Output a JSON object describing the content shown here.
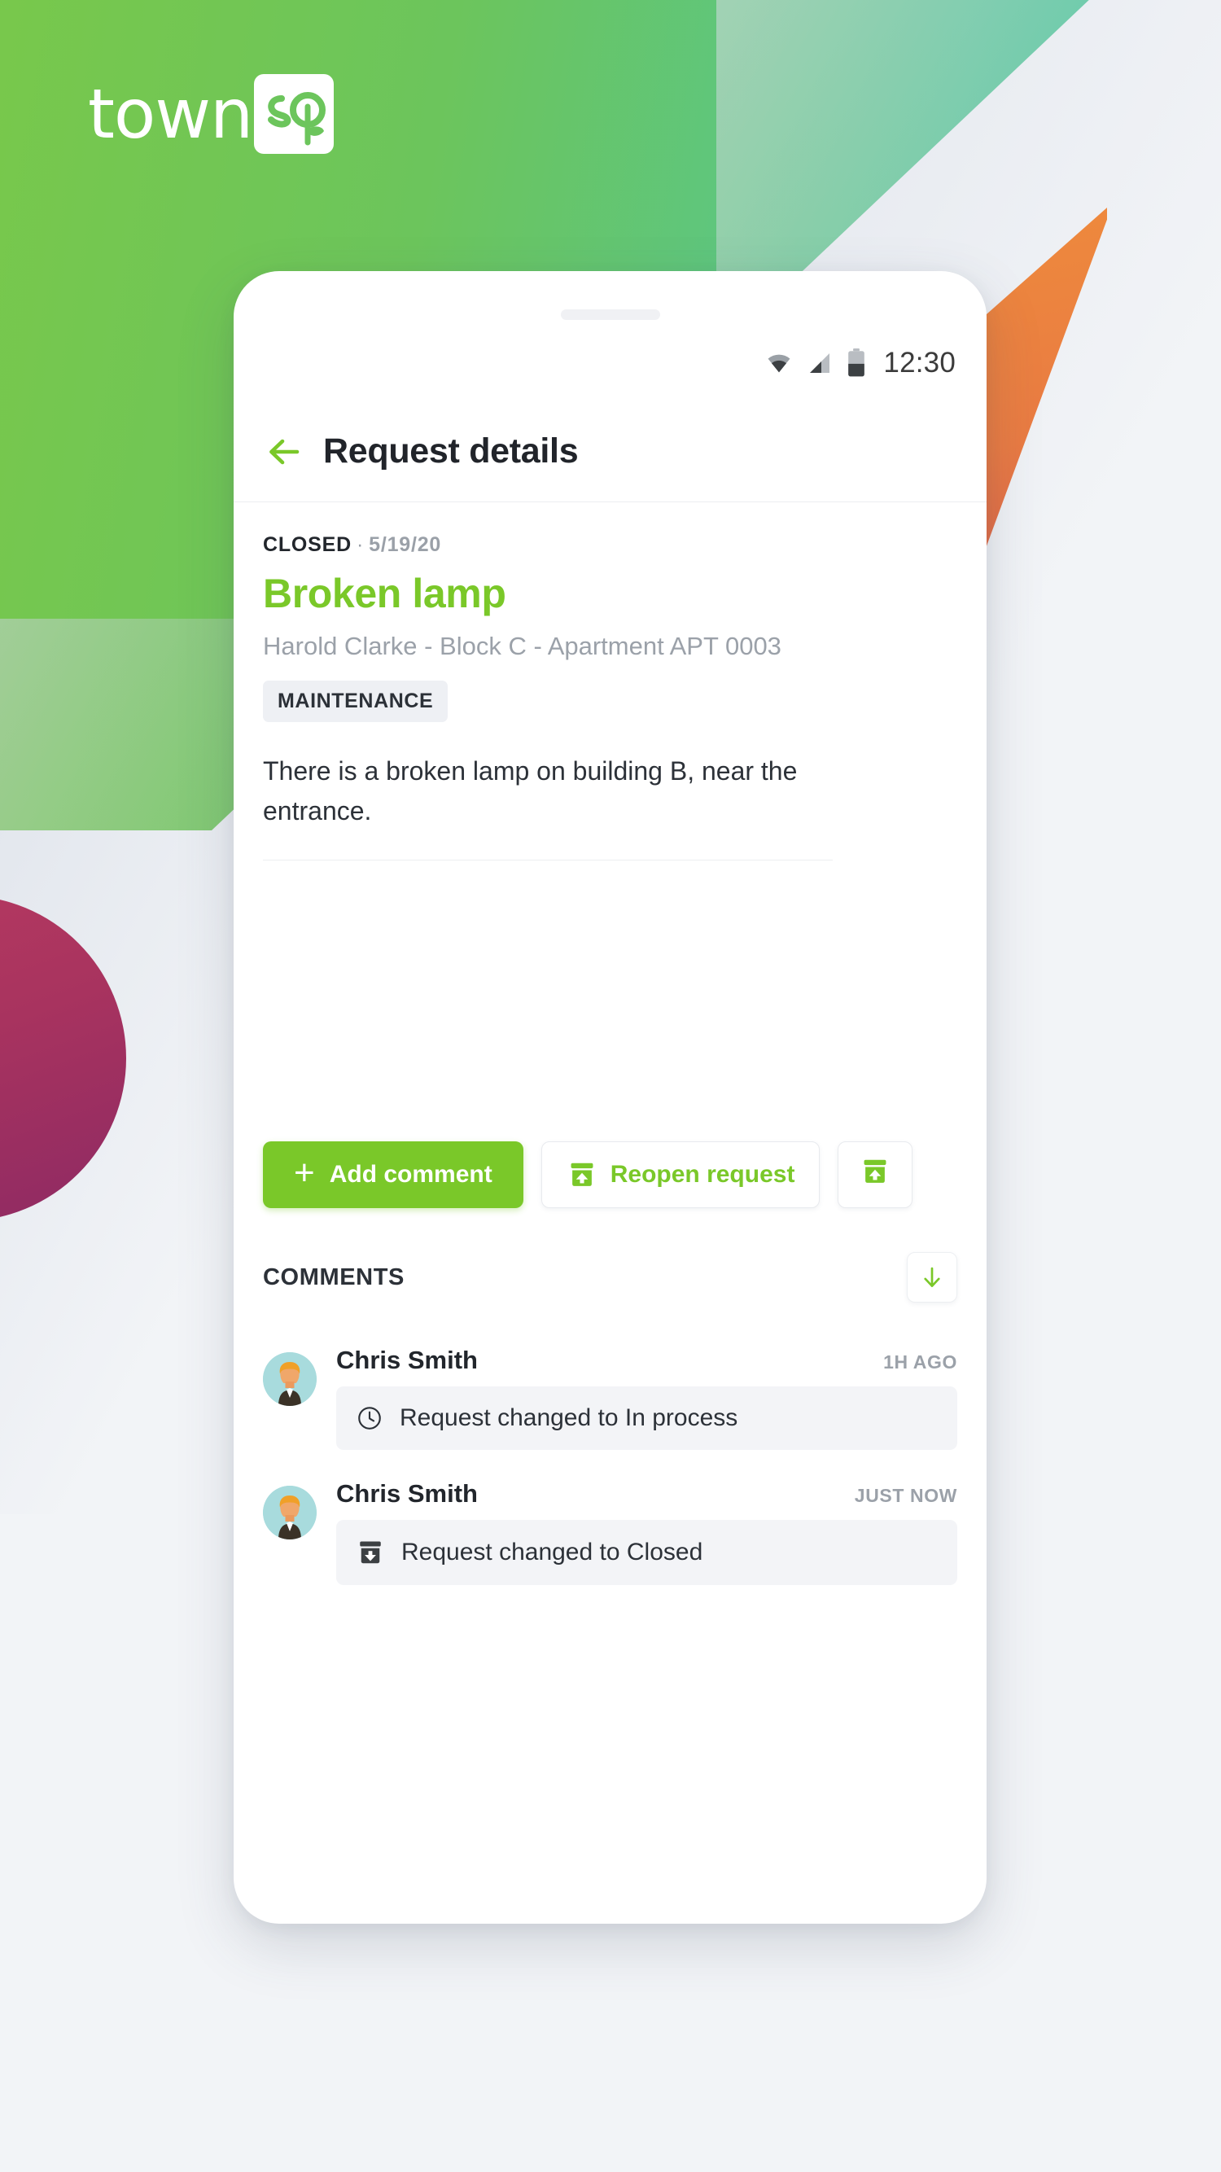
{
  "brand": {
    "logo_word": "town",
    "logo_mark_alt": "sq",
    "accent_green": "#7ac829",
    "brand_green": "#6cc55c",
    "brand_teal": "#44c5a0",
    "accent_orange": "#ef8c3b",
    "accent_magenta": "#a8335f"
  },
  "statusbar": {
    "wifi_icon": "wifi-icon",
    "signal_icon": "signal-icon",
    "battery_icon": "battery-icon",
    "time": "12:30"
  },
  "header": {
    "back_icon": "arrow-left-icon",
    "title": "Request details"
  },
  "request": {
    "status": "CLOSED",
    "separator": "·",
    "date": "5/19/20",
    "title": "Broken lamp",
    "subtitle": "Harold Clarke - Block C - Apartment APT 0003",
    "tag": "MAINTENANCE",
    "description": "There is a broken lamp on building B, near the entrance."
  },
  "actions": [
    {
      "label": "Add comment",
      "icon": "plus-icon",
      "style": "primary"
    },
    {
      "label": "Reopen request",
      "icon": "unarchive-icon",
      "style": "outline"
    },
    {
      "label": "",
      "icon": "unarchive-icon",
      "style": "icon-only"
    }
  ],
  "comments_section": {
    "title": "COMMENTS",
    "sort_icon": "arrow-down-icon"
  },
  "comments": [
    {
      "author": "Chris Smith",
      "time": "1H AGO",
      "icon": "clock-icon",
      "text": "Request changed to In process",
      "avatar": "user-avatar"
    },
    {
      "author": "Chris Smith",
      "time": "JUST NOW",
      "icon": "archive-down-icon",
      "text": "Request changed to Closed",
      "avatar": "user-avatar"
    }
  ]
}
